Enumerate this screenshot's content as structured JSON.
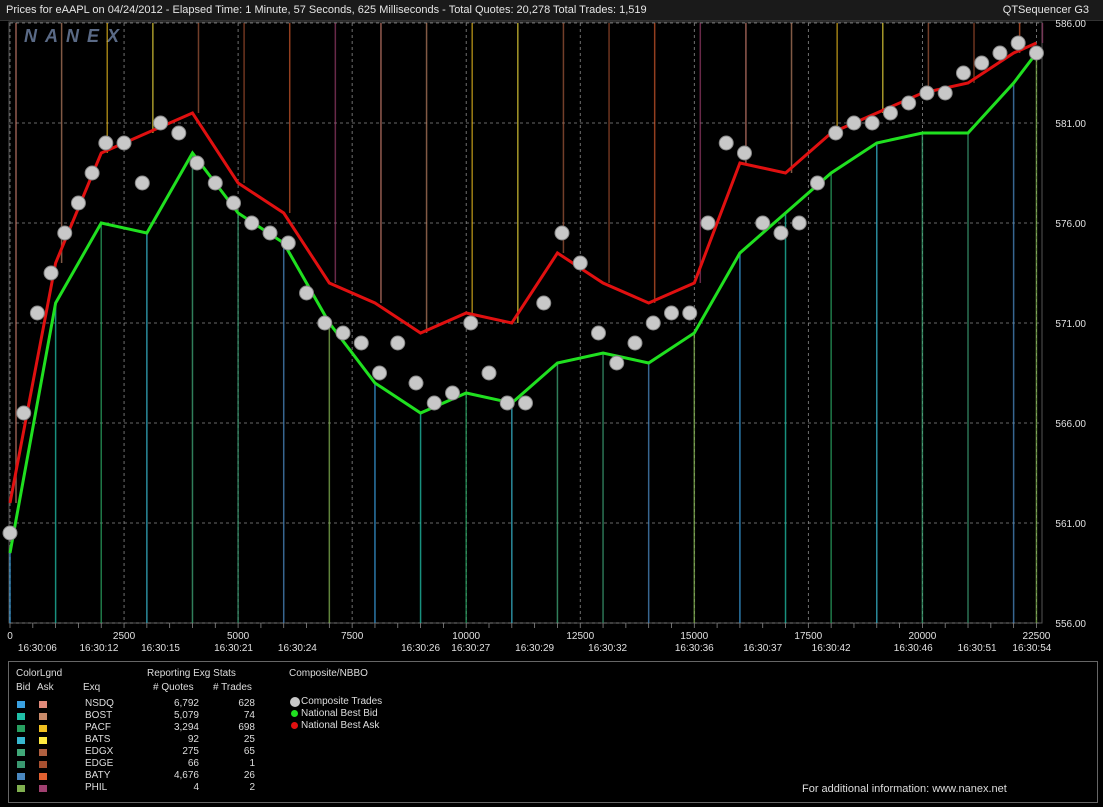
{
  "header": {
    "left_text": "Prices for  eAAPL  on  04/24/2012  -  Elapsed Time: 1 Minute, 57 Seconds, 625 Milliseconds  -  Total Quotes: 20,278  Total Trades: 1,519",
    "right_text": "QTSequencer G3"
  },
  "watermark": "NANEX",
  "chart_data": {
    "type": "line",
    "y_tick_labels": [
      "586.00",
      "581.00",
      "576.00",
      "571.00",
      "566.00",
      "561.00",
      "556.00"
    ],
    "y_ticks": [
      586,
      581,
      576,
      571,
      566,
      561,
      556
    ],
    "ylim": [
      556,
      586
    ],
    "x_count_labels": [
      "0",
      "2500",
      "5000",
      "7500",
      "10000",
      "12500",
      "15000",
      "17500",
      "20000",
      "22500"
    ],
    "x_counts": [
      0,
      2500,
      5000,
      7500,
      10000,
      12500,
      15000,
      17500,
      20000,
      22500
    ],
    "x_time_labels": [
      "16:30:06",
      "16:30:12",
      "16:30:15",
      "16:30:21",
      "16:30:24",
      "16:30:26",
      "16:30:27",
      "16:30:29",
      "16:30:32",
      "16:30:36",
      "16:30:37",
      "16:30:42",
      "16:30:46",
      "16:30:51",
      "16:30:54"
    ],
    "x_time_positions": [
      600,
      1950,
      3300,
      4900,
      6300,
      9000,
      10100,
      11500,
      13100,
      15000,
      16500,
      18000,
      19800,
      21200,
      22400
    ],
    "xlim": [
      0,
      22600
    ],
    "grid": true,
    "series": [
      {
        "name": "Composite Trades",
        "x": [
          0,
          300,
          600,
          900,
          1200,
          1500,
          1800,
          2100,
          2500,
          2900,
          3300,
          3700,
          4100,
          4500,
          4900,
          5300,
          5700,
          6100,
          6500,
          6900,
          7300,
          7700,
          8100,
          8500,
          8900,
          9300,
          9700,
          10100,
          10500,
          10900,
          11300,
          11700,
          12100,
          12500,
          12900,
          13300,
          13700,
          14100,
          14500,
          14900,
          15300,
          15700,
          16100,
          16500,
          16900,
          17300,
          17700,
          18100,
          18500,
          18900,
          19300,
          19700,
          20100,
          20500,
          20900,
          21300,
          21700,
          22100,
          22500
        ],
        "y": [
          560.5,
          566.5,
          571.5,
          573.5,
          575.5,
          577.0,
          578.5,
          580.0,
          580.0,
          578.0,
          581.0,
          580.5,
          579.0,
          578.0,
          577.0,
          576.0,
          575.5,
          575.0,
          572.5,
          571.0,
          570.5,
          570.0,
          568.5,
          570.0,
          568.0,
          567.0,
          567.5,
          571.0,
          568.5,
          567.0,
          567.0,
          572.0,
          575.5,
          574.0,
          570.5,
          569.0,
          570.0,
          571.0,
          571.5,
          571.5,
          576.0,
          580.0,
          579.5,
          576.0,
          575.5,
          576.0,
          578.0,
          580.5,
          581.0,
          581.0,
          581.5,
          582.0,
          582.5,
          582.5,
          583.5,
          584.0,
          584.5,
          585.0,
          584.5
        ]
      },
      {
        "name": "National Best Bid",
        "x": [
          0,
          1000,
          2000,
          3000,
          4000,
          5000,
          6000,
          7000,
          8000,
          9000,
          10000,
          11000,
          12000,
          13000,
          14000,
          15000,
          16000,
          17000,
          18000,
          19000,
          20000,
          21000,
          22000,
          22500
        ],
        "y": [
          559.5,
          572.0,
          576.0,
          575.5,
          579.5,
          576.5,
          575.0,
          571.0,
          568.0,
          566.5,
          567.5,
          567.0,
          569.0,
          569.5,
          569.0,
          570.5,
          574.5,
          576.5,
          578.5,
          580.0,
          580.5,
          580.5,
          583.0,
          584.5
        ]
      },
      {
        "name": "National Best Ask",
        "x": [
          0,
          1000,
          2000,
          3000,
          4000,
          5000,
          6000,
          7000,
          8000,
          9000,
          10000,
          11000,
          12000,
          13000,
          14000,
          15000,
          16000,
          17000,
          18000,
          19000,
          20000,
          21000,
          22000,
          22500
        ],
        "y": [
          562.0,
          574.0,
          579.5,
          580.5,
          581.5,
          578.0,
          576.5,
          573.0,
          572.0,
          570.5,
          571.5,
          571.0,
          574.5,
          573.0,
          572.0,
          573.0,
          579.0,
          578.5,
          580.5,
          581.5,
          582.5,
          583.0,
          584.5,
          585.0
        ]
      }
    ]
  },
  "legend": {
    "colorlgnd_title": "ColorLgnd",
    "bid_header": "Bid",
    "ask_header": "Ask",
    "exq_header": "Exq",
    "stats_title": "Reporting Exg Stats",
    "quotes_header": "# Quotes",
    "trades_header": "# Trades",
    "composite_title": "Composite/NBBO",
    "rows": [
      {
        "exq": "NSDQ",
        "quotes": "6,792",
        "trades": "628",
        "bid_color": "#3aa0e0",
        "ask_color": "#e08a7a"
      },
      {
        "exq": "BOST",
        "quotes": "5,079",
        "trades": "74",
        "bid_color": "#20c0a8",
        "ask_color": "#c88a6a"
      },
      {
        "exq": "PACF",
        "quotes": "3,294",
        "trades": "698",
        "bid_color": "#28a060",
        "ask_color": "#f0c020"
      },
      {
        "exq": "BATS",
        "quotes": "92",
        "trades": "25",
        "bid_color": "#38b8d0",
        "ask_color": "#ffea40"
      },
      {
        "exq": "EDGX",
        "quotes": "275",
        "trades": "65",
        "bid_color": "#40a878",
        "ask_color": "#b06040"
      },
      {
        "exq": "EDGE",
        "quotes": "66",
        "trades": "1",
        "bid_color": "#3a9870",
        "ask_color": "#a85030"
      },
      {
        "exq": "BATY",
        "quotes": "4,676",
        "trades": "26",
        "bid_color": "#4a88c0",
        "ask_color": "#e06030"
      },
      {
        "exq": "PHIL",
        "quotes": "4",
        "trades": "2",
        "bid_color": "#80b050",
        "ask_color": "#a04070"
      }
    ],
    "composite_items": [
      {
        "label": "Composite Trades",
        "color": "#c8c8c8"
      },
      {
        "label": "National Best Bid",
        "color": "#20e020"
      },
      {
        "label": "National Best Ask",
        "color": "#e01010"
      }
    ],
    "footer": "For additional information: www.nanex.net"
  }
}
